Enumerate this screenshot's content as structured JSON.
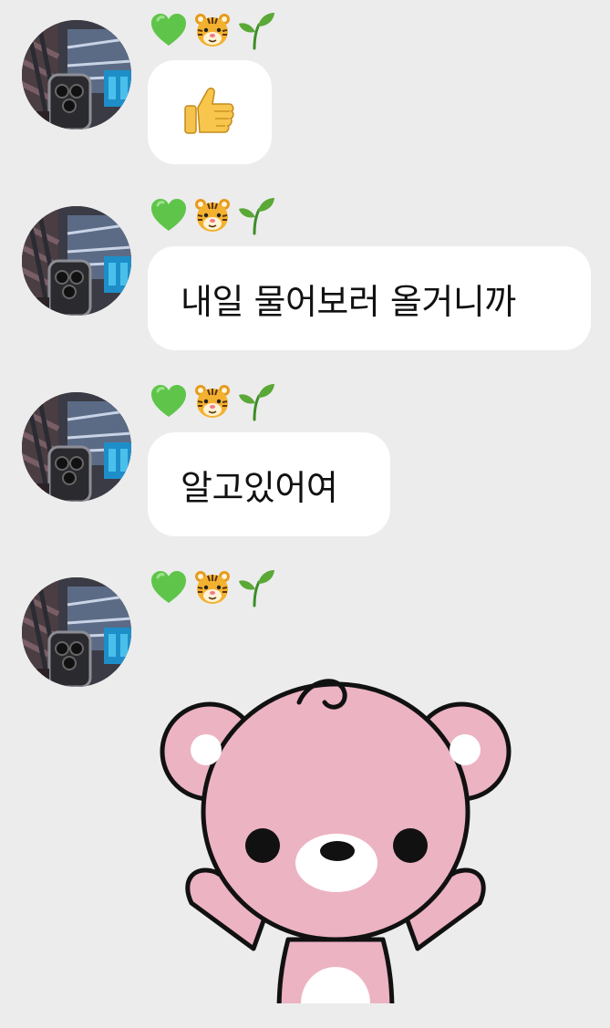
{
  "sender": {
    "nickname_icons": [
      "green-heart-icon",
      "tiger-face-icon",
      "seedling-icon"
    ],
    "colors": {
      "heart": "#5fc54a",
      "seedling": "#5aa836"
    }
  },
  "messages": [
    {
      "type": "emoji",
      "content_icon": "thumbs-up-icon"
    },
    {
      "type": "text",
      "text": "내일 물어보러 올거니까"
    },
    {
      "type": "text",
      "text": "알고있어여"
    },
    {
      "type": "sticker",
      "content_icon": "pink-bear-waving-sticker"
    }
  ],
  "colors": {
    "background": "#ececec",
    "bubble": "#ffffff",
    "bear_pink": "#ecb3c3",
    "bear_outline": "#111111"
  }
}
